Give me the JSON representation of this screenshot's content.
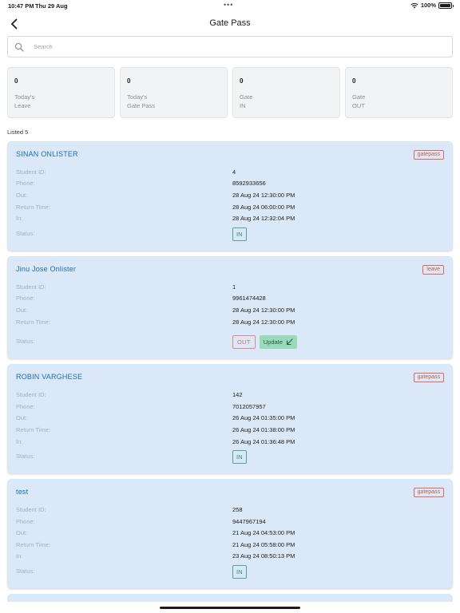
{
  "status_bar": {
    "time": "10:47 PM",
    "date": "Thu 29 Aug",
    "battery": "100%",
    "battery_level": 1.0
  },
  "header": {
    "title": "Gate Pass"
  },
  "search": {
    "placeholder": "Search"
  },
  "stats": [
    {
      "count": "0",
      "label": "Today's\nLeave"
    },
    {
      "count": "0",
      "label": "Today's\nGate Pass"
    },
    {
      "count": "0",
      "label": "Gate\nIN"
    },
    {
      "count": "0",
      "label": "Gate\nOUT"
    }
  ],
  "listed_text": "Listed 5",
  "labels": {
    "student_id": "Student ID:",
    "phone": "Phone:",
    "out": "Out:",
    "return_time": "Return Time:",
    "in": "In:",
    "status": "Status:",
    "in_pill": "IN",
    "out_pill": "OUT",
    "update": "Update"
  },
  "cards": [
    {
      "name": "SINAN ONLISTER",
      "type": "gatepass",
      "student_id": "4",
      "phone": "8592933656",
      "out": "28 Aug 24 12:30:00 PM",
      "return_time": "28 Aug 24 06:00:00 PM",
      "in": "28 Aug 24 12:32:04 PM",
      "status": "IN"
    },
    {
      "name": "Jinu Jose Onlister",
      "type": "leave",
      "student_id": "1",
      "phone": "9961474428",
      "out": "28 Aug 24 12:30:00 PM",
      "return_time": "28 Aug 24 12:30:00 PM",
      "in": null,
      "status": "OUT"
    },
    {
      "name": "ROBIN VARGHESE",
      "type": "gatepass",
      "student_id": "142",
      "phone": "7012057957",
      "out": "26 Aug 24 01:35:00 PM",
      "return_time": "26 Aug 24 01:38:00 PM",
      "in": "26 Aug 24 01:36:48 PM",
      "status": "IN"
    },
    {
      "name": "test",
      "type": "gatepass",
      "student_id": "258",
      "phone": "9447967194",
      "out": "21 Aug 24 04:53:00 PM",
      "return_time": "21 Aug 24 05:58:00 PM",
      "in": "23 Aug 24 08:50:13 PM",
      "status": "IN"
    }
  ],
  "colors": {
    "card_bg": "#dbe8f8",
    "accent_blue": "#1e6cb0",
    "badge_red": "#d05a4c",
    "in_green": "#2f8f76",
    "update_green": "#9bd9bb"
  }
}
